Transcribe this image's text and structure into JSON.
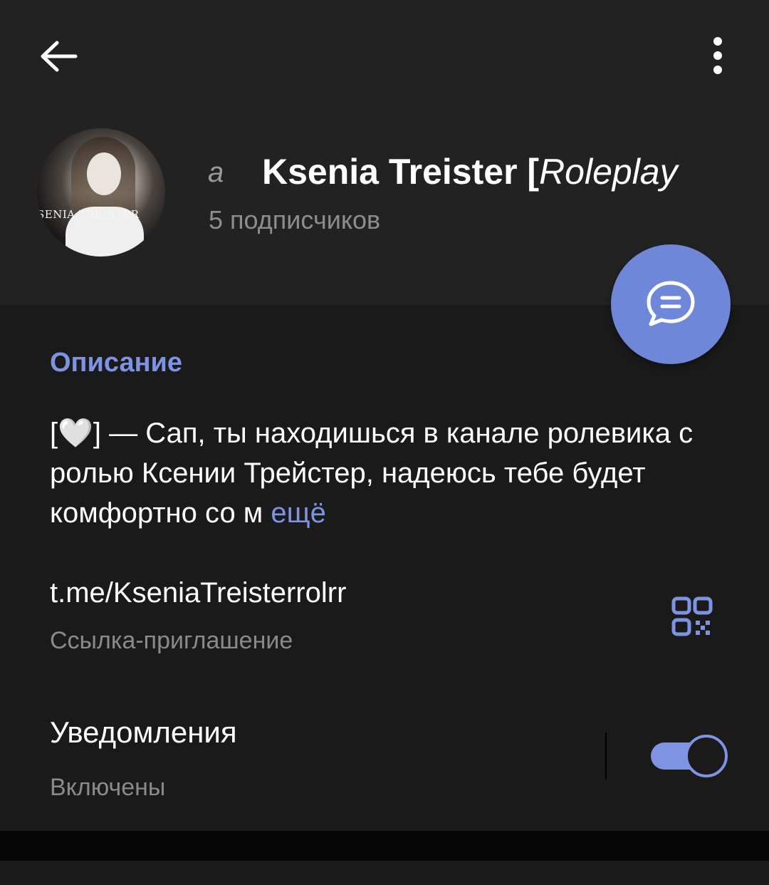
{
  "header": {
    "title_fragment": "a",
    "title_bold": "Ksenia Treister [",
    "title_italic": "Roleplay",
    "subscribers": "5 подписчиков",
    "avatar_badge": "SENIA TREISTER"
  },
  "icons": {
    "back": "arrow-left-icon",
    "menu": "more-vert-icon",
    "fab": "chat-bubble-icon",
    "qr": "qr-code-icon"
  },
  "description": {
    "section_title": "Описание",
    "text": "[🤍] — Сап, ты находишься в канале ролевика с ролью Ксении Трейстер, надеюсь тебе будет комфортно со м",
    "more_label": "ещё"
  },
  "invite": {
    "link": "t.me/KseniaTreisterrolrr",
    "label": "Ссылка-приглашение"
  },
  "notifications": {
    "title": "Уведомления",
    "status": "Включены",
    "enabled": true
  },
  "colors": {
    "accent": "#7f93e3",
    "fab": "#6f87d8",
    "header_bg": "#222222",
    "panel_bg": "#1a1a1a"
  }
}
